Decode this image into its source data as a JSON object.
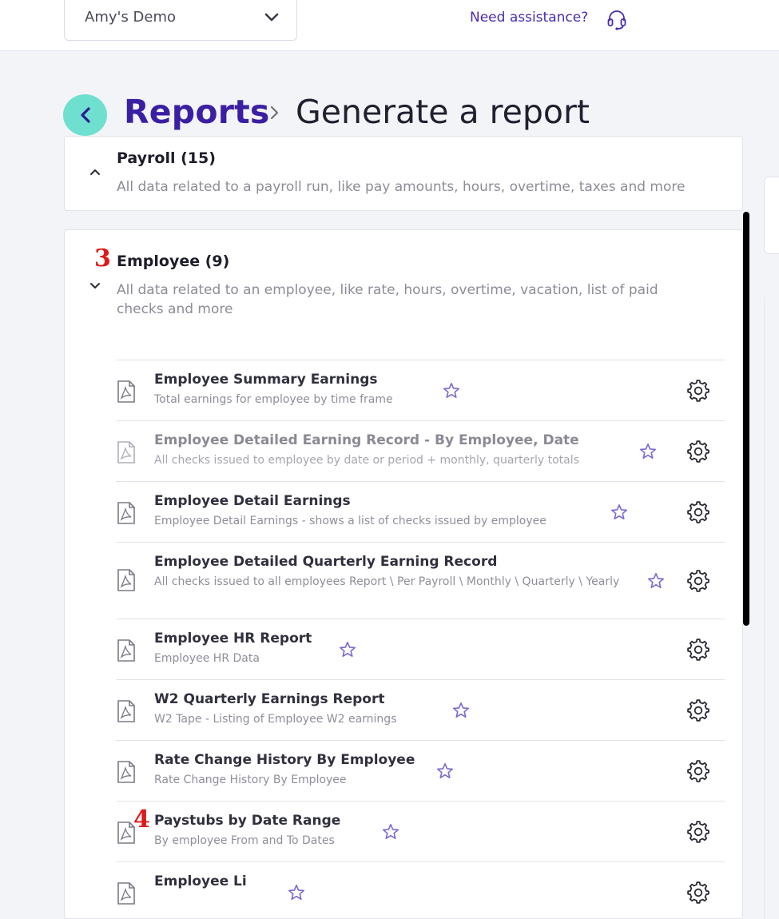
{
  "topbar": {
    "company": "Amy's Demo",
    "help": "Need assistance?"
  },
  "breadcrumb": {
    "parent": "Reports",
    "current": "Generate a report"
  },
  "categories": [
    {
      "title": "Payroll (15)",
      "description": "All data related to a payroll run, like pay amounts, hours, overtime, taxes and more",
      "expanded": false
    },
    {
      "title": "Employee (9)",
      "description": "All data related to an employee, like rate, hours, overtime, vacation, list of paid checks and more",
      "expanded": true
    }
  ],
  "annotations": {
    "step3": "3",
    "step4": "4"
  },
  "reports": [
    {
      "name": "Employee Summary Earnings",
      "description": "Total earnings for employee by time frame",
      "faded": false
    },
    {
      "name": "Employee Detailed Earning Record - By Employee, Date",
      "description": "All checks issued to employee by date or period + monthly, quarterly totals",
      "faded": true
    },
    {
      "name": "Employee Detail Earnings",
      "description": "Employee Detail Earnings - shows a list of checks issued by employee",
      "faded": false
    },
    {
      "name": "Employee Detailed Quarterly Earning Record",
      "description": "All checks issued to all employees Report \\ Per Payroll \\ Monthly \\ Quarterly \\ Yearly",
      "faded": false
    },
    {
      "name": "Employee HR Report",
      "description": "Employee HR Data",
      "faded": false
    },
    {
      "name": "W2 Quarterly Earnings Report",
      "description": "W2 Tape - Listing of Employee W2 earnings",
      "faded": false
    },
    {
      "name": "Rate Change History By Employee",
      "description": "Rate Change History By Employee",
      "faded": false
    },
    {
      "name": "Paystubs by Date Range",
      "description": "By employee From and To Dates",
      "faded": false
    },
    {
      "name": "Employee Li",
      "description": "",
      "faded": false
    }
  ],
  "icons": {
    "accent": "#4b2bb0",
    "back_button_bg": "#6fe0cf",
    "annotation_color": "#e01818"
  }
}
